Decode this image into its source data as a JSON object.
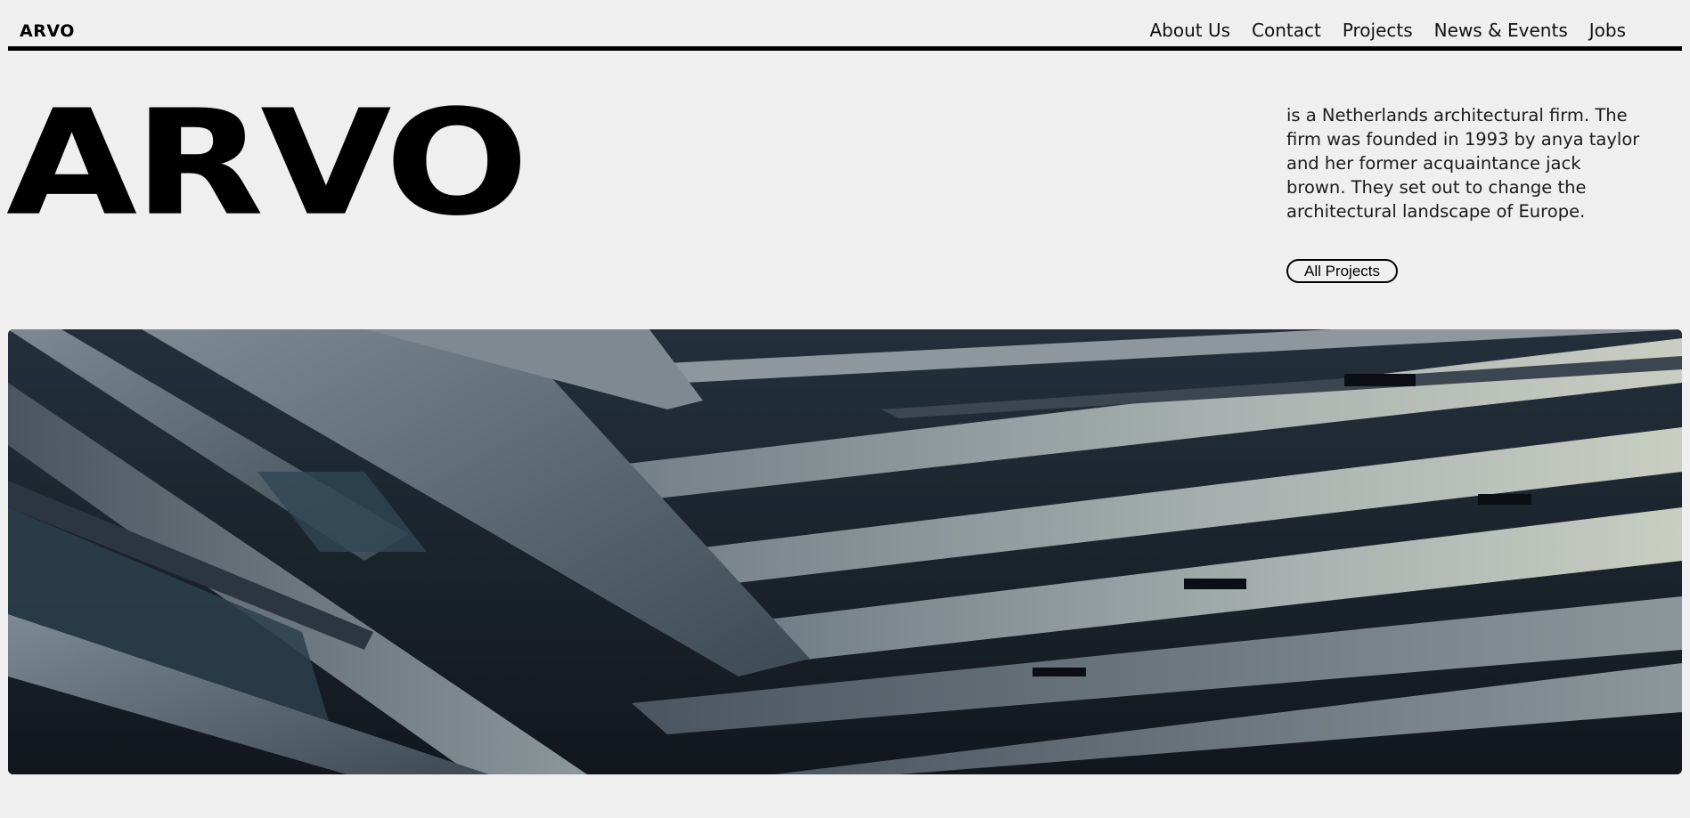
{
  "nav": {
    "logo": "ARVO",
    "items": [
      {
        "label": "About Us"
      },
      {
        "label": "Contact"
      },
      {
        "label": "Projects"
      },
      {
        "label": "News & Events"
      },
      {
        "label": "Jobs"
      }
    ]
  },
  "hero": {
    "title": "ARVO",
    "description": "is a Netherlands architectural firm. The firm was founded in 1993 by anya taylor and her former acquaintance jack brown. They set out to change the architectural landscape of Europe.",
    "cta_label": "All Projects",
    "image_subject": "modern building facade with angled metal fins"
  },
  "colors": {
    "background": "#efefef",
    "text": "#000000"
  }
}
